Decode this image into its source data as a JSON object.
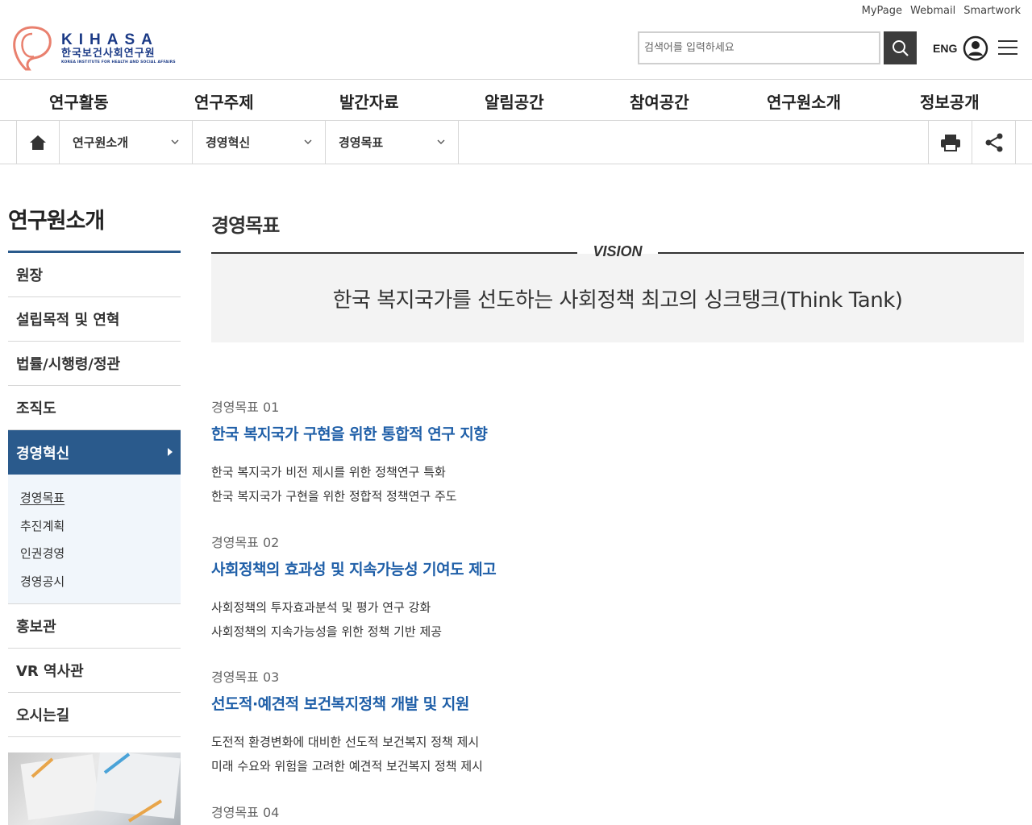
{
  "utility_links": [
    "MyPage",
    "Webmail",
    "Smartwork"
  ],
  "logo": {
    "name_en": "KIHASA",
    "name_ko": "한국보건사회연구원",
    "subtitle": "KOREA INSTITUTE FOR HEALTH AND SOCIAL AFFAIRS"
  },
  "search": {
    "placeholder": "검색어를 입력하세요"
  },
  "header": {
    "lang_label": "ENG"
  },
  "gnb": [
    "연구활동",
    "연구주제",
    "발간자료",
    "알림공간",
    "참여공간",
    "연구원소개",
    "정보공개"
  ],
  "location": [
    "연구원소개",
    "경영혁신",
    "경영목표"
  ],
  "sidebar": {
    "title": "연구원소개",
    "items": [
      "원장",
      "설립목적 및 연혁",
      "법률/시행령/정관",
      "조직도",
      "경영혁신",
      "홍보관",
      "VR 역사관",
      "오시는길"
    ],
    "sub_items": [
      "경영목표",
      "추진계획",
      "인권경영",
      "경영공시"
    ]
  },
  "main": {
    "title": "경영목표",
    "vision_label": "VISION",
    "vision_text": "한국 복지국가를 선도하는 사회정책 최고의 싱크탱크(Think Tank)",
    "goals": [
      {
        "label": "경영목표 01",
        "title": "한국 복지국가 구현을 위한 통합적 연구 지향",
        "lines": [
          "한국 복지국가 비전 제시를 위한 정책연구 특화",
          "한국 복지국가 구현을 위한 정합적 정책연구 주도"
        ]
      },
      {
        "label": "경영목표 02",
        "title": "사회정책의 효과성 및 지속가능성 기여도 제고",
        "lines": [
          "사회정책의 투자효과분석 및 평가 연구 강화",
          "사회정책의 지속가능성을 위한 정책 기반 제공"
        ]
      },
      {
        "label": "경영목표 03",
        "title": "선도적·예견적 보건복지정책 개발 및 지원",
        "lines": [
          "도전적 환경변화에 대비한 선도적 보건복지 정책 제시",
          "미래 수요와 위험을 고려한 예견적 보건복지 정책 제시"
        ]
      },
      {
        "label": "경영목표 04",
        "title": "",
        "lines": []
      }
    ]
  },
  "colors": {
    "brand_navy": "#1b3a86",
    "sidebar_active": "#2a5a8c",
    "goal_title": "#1f5fa8",
    "logo_accent": "#e9806e"
  },
  "icons": [
    "search-icon",
    "user-icon",
    "hamburger-menu-icon",
    "home-icon",
    "chevron-down-icon",
    "print-icon",
    "share-icon"
  ]
}
